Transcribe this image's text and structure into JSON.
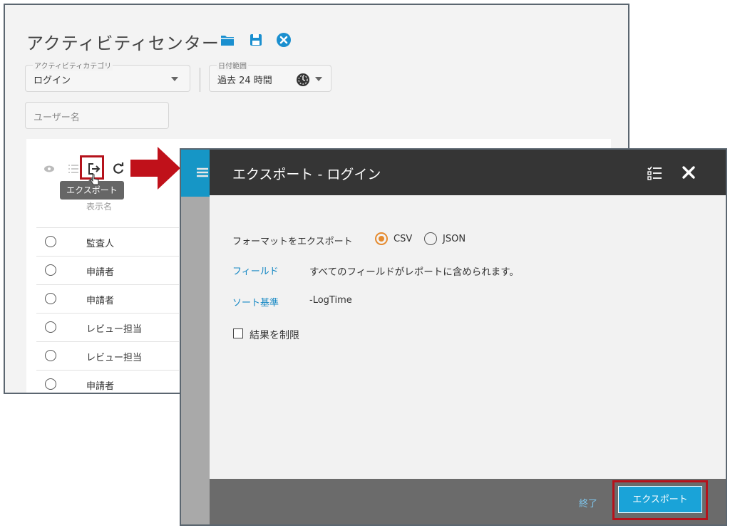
{
  "activity_center": {
    "title": "アクティビティセンター",
    "toolbar_icons": [
      "folder-icon",
      "save-icon",
      "close-circle-icon"
    ],
    "category": {
      "label": "アクティビティカテゴリ",
      "value": "ログイン"
    },
    "date_range": {
      "label": "日付範囲",
      "value": "過去 24 時間"
    },
    "username_placeholder": "ユーザー名",
    "table": {
      "column_header": "表示名",
      "rows": [
        "監査人",
        "申請者",
        "申請者",
        "レビュー担当",
        "レビュー担当",
        "申請者"
      ]
    },
    "tooltip": "エクスポート"
  },
  "export_dialog": {
    "title": "エクスポート - ログイン",
    "format_label": "フォーマットをエクスポート",
    "formats": [
      {
        "label": "CSV",
        "selected": true
      },
      {
        "label": "JSON",
        "selected": false
      }
    ],
    "fields_label": "フィールド",
    "fields_value": "すべてのフィールドがレポートに含められます。",
    "sort_label": "ソート基準",
    "sort_value": "-LogTime",
    "limit_label": "結果を制限",
    "limit_checked": false,
    "close_label": "終了",
    "export_label": "エクスポート"
  },
  "colors": {
    "accent": "#1aa3d8",
    "highlight": "#b5121b",
    "radio_selected": "#e58a2e",
    "header_dark": "#353535"
  }
}
